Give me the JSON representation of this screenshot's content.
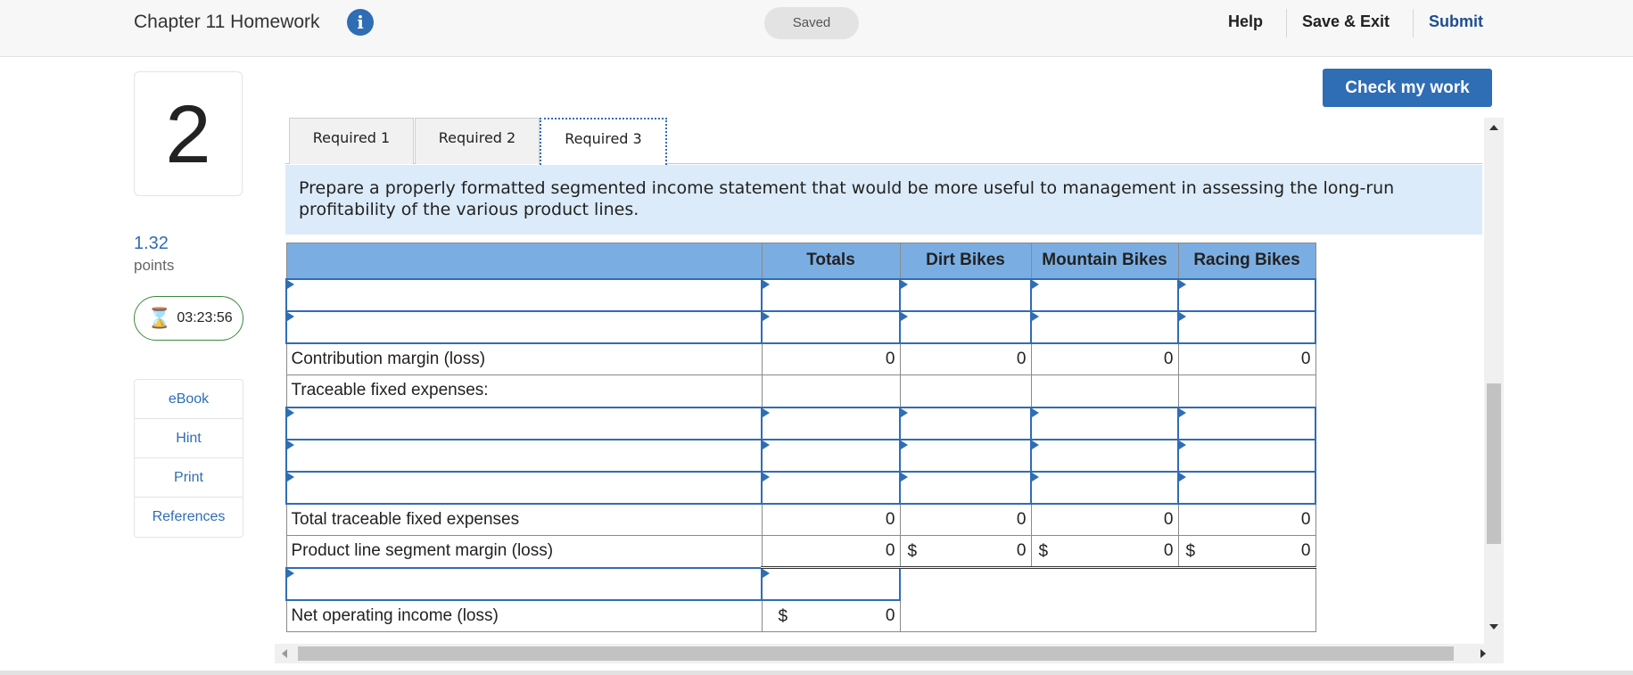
{
  "header": {
    "title": "Chapter 11 Homework",
    "info_icon": "i",
    "saved_label": "Saved",
    "help_label": "Help",
    "save_exit_label": "Save & Exit",
    "submit_label": "Submit"
  },
  "question": {
    "number": "2",
    "points_value": "1.32",
    "points_label": "points",
    "timer": "03:23:56"
  },
  "sidebar": {
    "items": [
      {
        "label": "eBook"
      },
      {
        "label": "Hint"
      },
      {
        "label": "Print"
      },
      {
        "label": "References"
      }
    ]
  },
  "check_button": "Check my work",
  "tabs": [
    {
      "label": "Required 1",
      "active": false
    },
    {
      "label": "Required 2",
      "active": false
    },
    {
      "label": "Required 3",
      "active": true
    }
  ],
  "instruction": "Prepare a properly formatted segmented income statement that would be more useful to management in assessing the long-run profitability of the various product lines.",
  "table": {
    "headers": [
      "",
      "Totals",
      "Dirt Bikes",
      "Mountain Bikes",
      "Racing Bikes"
    ],
    "contribution_label": "Contribution margin (loss)",
    "contribution_values": [
      "0",
      "0",
      "0",
      "0"
    ],
    "traceable_label": "Traceable fixed expenses:",
    "total_traceable_label": "Total traceable fixed expenses",
    "total_traceable_values": [
      "0",
      "0",
      "0",
      "0"
    ],
    "segment_margin_label": "Product line segment margin (loss)",
    "segment_margin_values": [
      "0",
      "0",
      "0",
      "0"
    ],
    "currency_symbol": "$",
    "net_income_label": "Net operating income (loss)",
    "net_income_value": "0"
  },
  "colors": {
    "accent": "#2f6db5",
    "table_header": "#7aaee3",
    "instruction_bg": "#dcebfa",
    "timer_border": "#3d8a3d"
  }
}
